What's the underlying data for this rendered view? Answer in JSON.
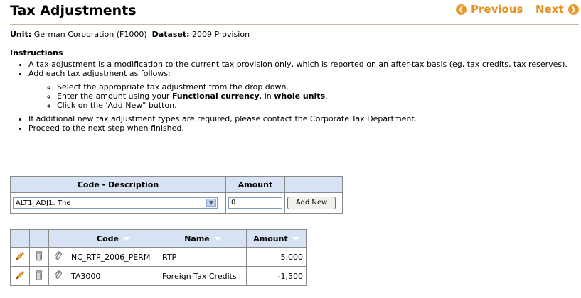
{
  "header": {
    "title": "Tax Adjustments",
    "previous_label": "Previous",
    "next_label": "Next"
  },
  "context": {
    "unit_label": "Unit:",
    "unit_value": "German Corporation (F1000)",
    "dataset_label": "Dataset:",
    "dataset_value": "2009 Provision"
  },
  "instructions": {
    "heading": "Instructions",
    "bullet1": "A tax adjustment is a modification to the current tax provision only, which is reported on an after-tax basis (eg, tax credits, tax reserves).",
    "bullet2": "Add each tax adjustment as follows:",
    "sub1": "Select the appropriate tax adjustment from the drop down.",
    "sub2_pre": "Enter the amount using your ",
    "sub2_b1": "Functional currency",
    "sub2_mid": ", in ",
    "sub2_b2": "whole units",
    "sub2_end": ".",
    "sub3": "Click on the 'Add New\" button.",
    "bullet3": "If additional new tax adjustment types are required, please contact the Corporate Tax Department.",
    "bullet4": "Proceed to the next step when finished."
  },
  "add_form": {
    "col_code_desc": "Code - Description",
    "col_amount": "Amount",
    "selected_code": "ALT1_ADJ1: The",
    "amount_value": "0",
    "add_button": "Add New"
  },
  "list": {
    "col_code": "Code",
    "col_name": "Name",
    "col_amount": "Amount",
    "rows": [
      {
        "code": "NC_RTP_2006_PERM",
        "name": "RTP",
        "amount": "5,000"
      },
      {
        "code": "TA3000",
        "name": "Foreign Tax Credits",
        "amount": "-1,500"
      }
    ]
  },
  "colors": {
    "accent": "#e8911c",
    "header_bg": "#d7e3f5",
    "rule": "#c9b999"
  },
  "icons": [
    "chevron-left-icon",
    "chevron-right-icon",
    "dropdown-arrow-icon",
    "pencil-icon",
    "trash-icon",
    "paperclip-icon",
    "sort-icon"
  ]
}
